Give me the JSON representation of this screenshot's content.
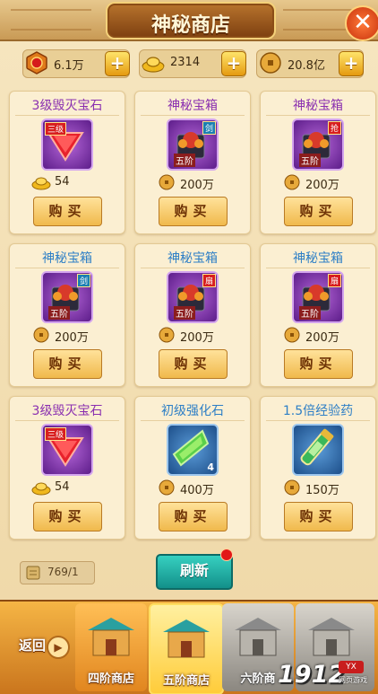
{
  "header": {
    "title": "神秘商店",
    "close_label": "✕"
  },
  "currencies": [
    {
      "icon": "medal-icon",
      "value": "6.1万"
    },
    {
      "icon": "gold-ingot-icon",
      "value": "2314"
    },
    {
      "icon": "copper-coin-icon",
      "value": "20.8亿"
    }
  ],
  "items": [
    {
      "name": "3级毁灭宝石",
      "icon": "ruby-gem-icon",
      "badge": "三级",
      "price_icon": "gold-ingot-icon",
      "price": "54",
      "buy_label": "购买"
    },
    {
      "name": "神秘宝箱",
      "icon": "treasure-box-icon",
      "badge": "剑",
      "step": "五阶",
      "price_icon": "copper-coin-icon",
      "price": "200万",
      "buy_label": "购买"
    },
    {
      "name": "神秘宝箱",
      "icon": "treasure-box-icon",
      "badge": "抢",
      "step": "五阶",
      "price_icon": "copper-coin-icon",
      "price": "200万",
      "buy_label": "购买"
    },
    {
      "name": "神秘宝箱",
      "icon": "treasure-box-icon",
      "badge": "剑",
      "step": "五阶",
      "price_icon": "copper-coin-icon",
      "price": "200万",
      "buy_label": "购买"
    },
    {
      "name": "神秘宝箱",
      "icon": "treasure-box-icon",
      "badge": "扇",
      "step": "五阶",
      "price_icon": "copper-coin-icon",
      "price": "200万",
      "buy_label": "购买"
    },
    {
      "name": "神秘宝箱",
      "icon": "treasure-box-icon",
      "badge": "扇",
      "step": "五阶",
      "price_icon": "copper-coin-icon",
      "price": "200万",
      "buy_label": "购买"
    },
    {
      "name": "3级毁灭宝石",
      "icon": "ruby-gem-icon",
      "badge": "三级",
      "price_icon": "gold-ingot-icon",
      "price": "54",
      "buy_label": "购买"
    },
    {
      "name": "初级强化石",
      "icon": "green-crystal-icon",
      "count": "4",
      "price_icon": "copper-coin-icon",
      "price": "400万",
      "buy_label": "购买"
    },
    {
      "name": "1.5倍经验药",
      "icon": "exp-potion-icon",
      "price_icon": "copper-coin-icon",
      "price": "150万",
      "buy_label": "购买"
    }
  ],
  "refresh": {
    "count": "769/1",
    "label": "刷新"
  },
  "bottom_nav": {
    "back_label": "返回",
    "shops": [
      {
        "label": "四阶商店",
        "state": "normal"
      },
      {
        "label": "五阶商店",
        "state": "selected"
      },
      {
        "label": "六阶商",
        "state": "locked"
      },
      {
        "label": "",
        "state": "locked"
      }
    ]
  },
  "watermark": {
    "number": "1912",
    "badge": "YX",
    "sub": "网页游戏"
  }
}
